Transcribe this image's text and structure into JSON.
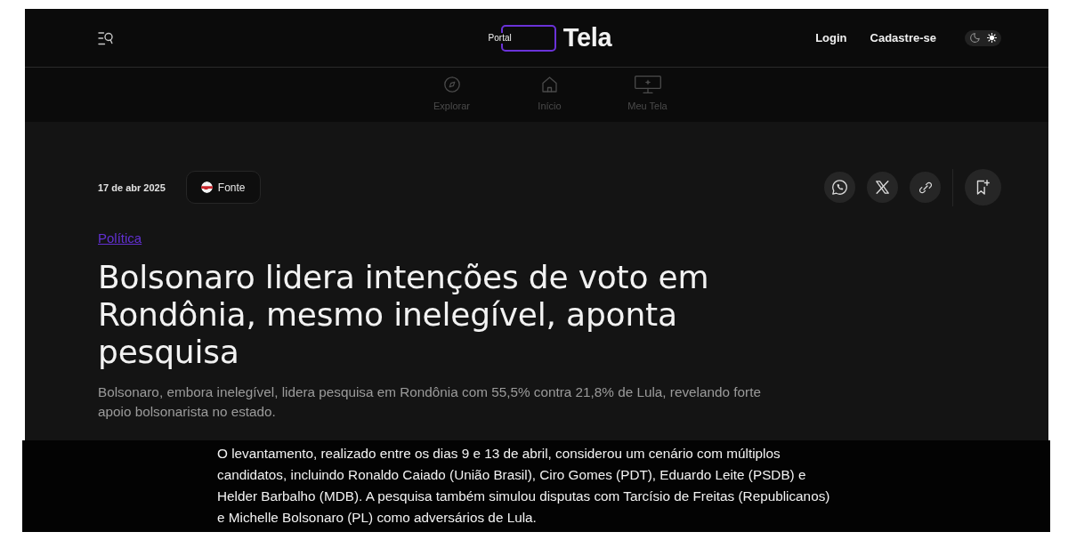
{
  "header": {
    "logo": {
      "prefix": "Portal",
      "name": "Tela"
    },
    "links": [
      {
        "label": "Login"
      },
      {
        "label": "Cadastre-se"
      }
    ],
    "theme_toggle": [
      {
        "kind": "moon",
        "selected": false
      },
      {
        "kind": "sun",
        "selected": true
      }
    ]
  },
  "nav": [
    {
      "kind": "compass",
      "label": "Explorar"
    },
    {
      "kind": "home",
      "label": "Início"
    },
    {
      "kind": "monitor",
      "label": "Meu Tela"
    }
  ],
  "article": {
    "date": "17 de abr 2025",
    "source_button": "Fonte",
    "share_buttons": [
      {
        "kind": "whatsapp"
      },
      {
        "kind": "x"
      },
      {
        "kind": "link"
      }
    ],
    "category": "Política",
    "title": "Bolsonaro lidera intenções de voto em Rondônia, mesmo inelegível, aponta pesquisa",
    "summary": "Bolsonaro, embora inelegível, lidera pesquisa em Rondônia com 55,5% contra 21,8% de Lula, revelando forte apoio bolsonarista no estado."
  },
  "body": {
    "paragraph": "O levantamento, realizado entre os dias 9 e 13 de abril, considerou um cenário com múltiplos candidatos, incluindo Ronaldo Caiado (União Brasil), Ciro Gomes (PDT), Eduardo Leite (PSDB) e Helder Barbalho (MDB). A pesquisa também simulou disputas com Tarcísio de Freitas (Republicanos) e Michelle Bolsonaro (PL) como adversários de Lula."
  }
}
